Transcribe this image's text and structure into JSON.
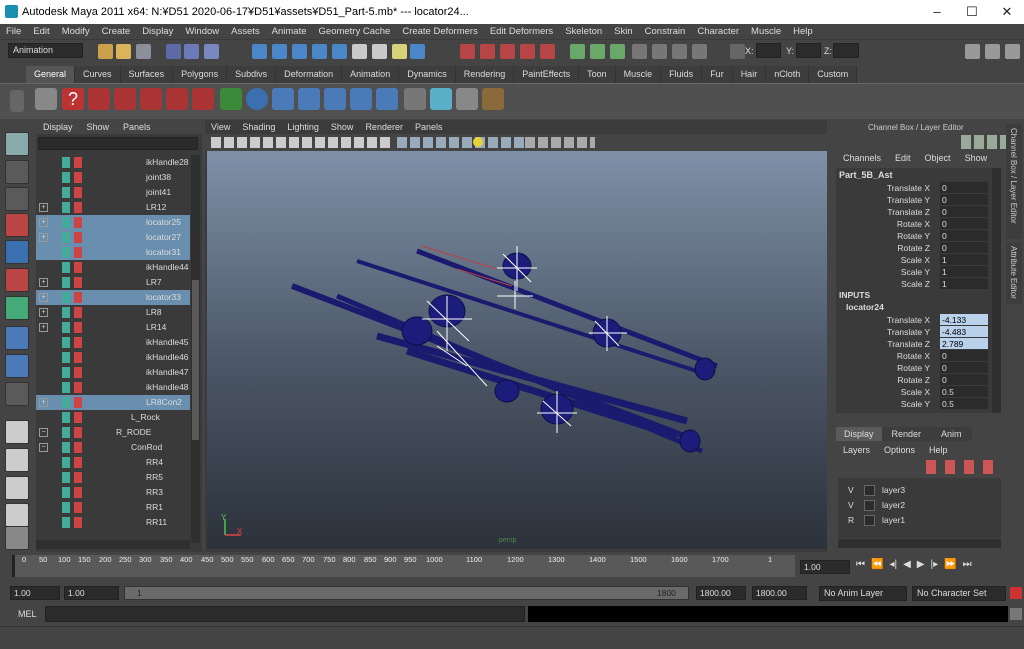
{
  "window": {
    "title": "Autodesk Maya 2011 x64: N:¥D51 2020-06-17¥D51¥assets¥D51_Part-5.mb*   ---   locator24...",
    "controls": [
      "–",
      "☐",
      "✕"
    ]
  },
  "menu": [
    "File",
    "Edit",
    "Modify",
    "Create",
    "Display",
    "Window",
    "Assets",
    "Animate",
    "Geometry Cache",
    "Create Deformers",
    "Edit Deformers",
    "Skeleton",
    "Skin",
    "Constrain",
    "Character",
    "Muscle",
    "Help"
  ],
  "status": {
    "mode": "Animation",
    "x_label": "X:",
    "y_label": "Y:",
    "z_label": "Z:"
  },
  "shelf_tabs": [
    "General",
    "Curves",
    "Surfaces",
    "Polygons",
    "Subdivs",
    "Deformation",
    "Animation",
    "Dynamics",
    "Rendering",
    "PaintEffects",
    "Toon",
    "Muscle",
    "Fluids",
    "Fur",
    "Hair",
    "nCloth",
    "Custom"
  ],
  "outliner": {
    "menu": [
      "Display",
      "Show",
      "Panels"
    ],
    "rows": [
      {
        "label": "ikHandle28",
        "sel": false,
        "expand": "",
        "indent": 110
      },
      {
        "label": "joint38",
        "sel": false,
        "expand": "",
        "indent": 110
      },
      {
        "label": "joint41",
        "sel": false,
        "expand": "",
        "indent": 110
      },
      {
        "label": "LR12",
        "sel": false,
        "expand": "+",
        "indent": 110
      },
      {
        "label": "locator25",
        "sel": true,
        "expand": "+",
        "indent": 110
      },
      {
        "label": "locator27",
        "sel": true,
        "expand": "+",
        "indent": 110
      },
      {
        "label": "locator31",
        "sel": true,
        "expand": "",
        "indent": 110
      },
      {
        "label": "ikHandle44",
        "sel": false,
        "expand": "",
        "indent": 110
      },
      {
        "label": "LR7",
        "sel": false,
        "expand": "+",
        "indent": 110
      },
      {
        "label": "locator33",
        "sel": true,
        "expand": "+",
        "indent": 110
      },
      {
        "label": "LR8",
        "sel": false,
        "expand": "+",
        "indent": 110
      },
      {
        "label": "LR14",
        "sel": false,
        "expand": "+",
        "indent": 110
      },
      {
        "label": "ikHandle45",
        "sel": false,
        "expand": "",
        "indent": 110
      },
      {
        "label": "ikHandle46",
        "sel": false,
        "expand": "",
        "indent": 110
      },
      {
        "label": "ikHandle47",
        "sel": false,
        "expand": "",
        "indent": 110
      },
      {
        "label": "ikHandle48",
        "sel": false,
        "expand": "",
        "indent": 110
      },
      {
        "label": "LR8Con2",
        "sel": true,
        "expand": "+",
        "indent": 110
      },
      {
        "label": "L_Rock",
        "sel": false,
        "expand": "",
        "indent": 95
      },
      {
        "label": "R_RODE",
        "sel": false,
        "expand": "−",
        "indent": 80
      },
      {
        "label": "ConRod",
        "sel": false,
        "expand": "−",
        "indent": 95
      },
      {
        "label": "RR4",
        "sel": false,
        "expand": "",
        "indent": 110
      },
      {
        "label": "RR5",
        "sel": false,
        "expand": "",
        "indent": 110
      },
      {
        "label": "RR3",
        "sel": false,
        "expand": "",
        "indent": 110
      },
      {
        "label": "RR1",
        "sel": false,
        "expand": "",
        "indent": 110
      },
      {
        "label": "RR11",
        "sel": false,
        "expand": "",
        "indent": 110
      }
    ]
  },
  "viewport": {
    "menu": [
      "View",
      "Shading",
      "Lighting",
      "Show",
      "Renderer",
      "Panels"
    ],
    "axis_y": "Y",
    "axis_x": "X",
    "camera": "persp"
  },
  "channel_box": {
    "header": "Channel Box / Layer Editor",
    "menu": [
      "Channels",
      "Edit",
      "Object",
      "Show"
    ],
    "object": "Part_5B_Ast",
    "attrs": [
      {
        "label": "Translate X",
        "value": "0"
      },
      {
        "label": "Translate Y",
        "value": "0"
      },
      {
        "label": "Translate Z",
        "value": "0"
      },
      {
        "label": "Rotate X",
        "value": "0"
      },
      {
        "label": "Rotate Y",
        "value": "0"
      },
      {
        "label": "Rotate Z",
        "value": "0"
      },
      {
        "label": "Scale X",
        "value": "1"
      },
      {
        "label": "Scale Y",
        "value": "1"
      },
      {
        "label": "Scale Z",
        "value": "1"
      }
    ],
    "inputs_label": "INPUTS",
    "input_object": "locator24",
    "input_attrs": [
      {
        "label": "Translate X",
        "value": "-4.133",
        "hl": true
      },
      {
        "label": "Translate Y",
        "value": "-4.483",
        "hl": true
      },
      {
        "label": "Translate Z",
        "value": "2.789",
        "hl": true
      },
      {
        "label": "Rotate X",
        "value": "0",
        "hl": false
      },
      {
        "label": "Rotate Y",
        "value": "0",
        "hl": false
      },
      {
        "label": "Rotate Z",
        "value": "0",
        "hl": false
      },
      {
        "label": "Scale X",
        "value": "0.5",
        "hl": false
      },
      {
        "label": "Scale Y",
        "value": "0.5",
        "hl": false
      }
    ],
    "side_tabs": [
      "Channel Box / Layer Editor",
      "Attribute Editor"
    ]
  },
  "layer_editor": {
    "tabs": [
      "Display",
      "Render",
      "Anim"
    ],
    "menu": [
      "Layers",
      "Options",
      "Help"
    ],
    "layers": [
      {
        "v": "V",
        "name": "layer3"
      },
      {
        "v": "V",
        "name": "layer2"
      },
      {
        "v": "R",
        "name": "layer1"
      }
    ]
  },
  "timeline": {
    "ticks": [
      "0",
      "50",
      "100",
      "150",
      "200",
      "250",
      "300",
      "350",
      "400",
      "450",
      "500",
      "550",
      "600",
      "650",
      "700",
      "750",
      "800",
      "850",
      "900",
      "950",
      "1000",
      "1100",
      "1200",
      "1300",
      "1400",
      "1500",
      "1600",
      "1700",
      "1"
    ],
    "current_frame": "1.00"
  },
  "range": {
    "start": "1.00",
    "start2": "1.00",
    "slider_start": "1",
    "slider_end": "1800",
    "end1": "1800.00",
    "end2": "1800.00",
    "anim_layer": "No Anim Layer",
    "char_set": "No Character Set"
  },
  "mel_label": "MEL"
}
